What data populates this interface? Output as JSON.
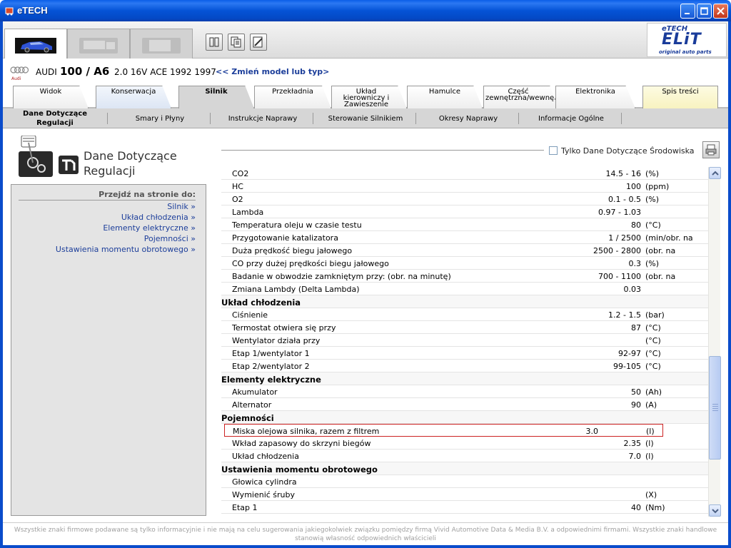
{
  "window": {
    "title": "eTECH",
    "icon": "etech-app-icon",
    "controls": [
      "minimize-icon",
      "maximize-icon",
      "close-icon"
    ]
  },
  "toolbar": {
    "vehicle_tabs": [
      {
        "name": "car",
        "icon": "car-icon",
        "active": true
      },
      {
        "name": "truck",
        "icon": "truck-icon",
        "active": false
      },
      {
        "name": "other",
        "icon": "van-icon",
        "active": false
      }
    ],
    "tools": [
      "tool-book-icon",
      "tool-copy-icon",
      "tool-edit-icon"
    ],
    "logo": {
      "top": "eTECH",
      "main": "ELiT",
      "sub": "original auto parts"
    }
  },
  "model": {
    "brand_logo_text": "Audi",
    "make": "AUDI",
    "name": "100 / A6",
    "spec": "2.0 16V ACE 1992 1997",
    "change_link": "<< Zmień model lub typ>"
  },
  "main_tabs": [
    {
      "label": "Widok",
      "style": "white"
    },
    {
      "label": "Konserwacja",
      "style": "blue"
    },
    {
      "label": "Silnik",
      "style": "active"
    },
    {
      "label": "Przekładnia",
      "style": "white"
    },
    {
      "label": "Układ kierowniczy i Zawieszenie",
      "style": "white"
    },
    {
      "label": "Hamulce",
      "style": "white"
    },
    {
      "label": "Część zewnętrzna/wewnętrzna",
      "style": "white"
    },
    {
      "label": "Elektronika",
      "style": "white"
    },
    {
      "label": "Spis treści",
      "style": "yellow"
    }
  ],
  "sub_nav": [
    {
      "label": "Dane Dotyczące Regulacji",
      "active": true
    },
    {
      "label": "Smary i Płyny",
      "active": false
    },
    {
      "label": "Instrukcje Naprawy",
      "active": false
    },
    {
      "label": "Sterowanie Silnikiem",
      "active": false
    },
    {
      "label": "Okresy Naprawy",
      "active": false
    },
    {
      "label": "Informacje Ogólne",
      "active": false
    }
  ],
  "left": {
    "section_title": "Dane Dotyczące Regulacji",
    "jump_title": "Przejdź na stronie do:",
    "jump_links": [
      "Silnik »",
      "Układ chłodzenia »",
      "Elementy elektryczne »",
      "Pojemności »",
      "Ustawienia momentu obrotowego »"
    ]
  },
  "right": {
    "env_checkbox_label": "Tylko Dane Dotyczące Środowiska",
    "env_checked": false,
    "rows": [
      {
        "type": "item",
        "name": "CO2",
        "value": "14.5 - 16",
        "unit": "(%)"
      },
      {
        "type": "item",
        "name": "HC",
        "value": "100",
        "unit": "(ppm)"
      },
      {
        "type": "item",
        "name": "O2",
        "value": "0.1 - 0.5",
        "unit": "(%)"
      },
      {
        "type": "item",
        "name": "Lambda",
        "value": "0.97 - 1.03",
        "unit": ""
      },
      {
        "type": "item",
        "name": "Temperatura oleju w czasie testu",
        "value": "80",
        "unit": "(°C)"
      },
      {
        "type": "item",
        "name": "Przygotowanie katalizatora",
        "value": "1 / 2500",
        "unit": "(min/obr. na"
      },
      {
        "type": "item",
        "name": "Duża prędkość biegu jałowego",
        "value": "2500 - 2800",
        "unit": "(obr. na"
      },
      {
        "type": "item",
        "name": "CO przy dużej prędkości biegu jałowego",
        "value": "0.3",
        "unit": "(%)"
      },
      {
        "type": "item",
        "name": "Badanie w obwodzie zamkniętym przy: (obr. na minutę)",
        "value": "700 - 1100",
        "unit": "(obr. na"
      },
      {
        "type": "item",
        "name": "Zmiana Lambdy (Delta Lambda)",
        "value": "0.03",
        "unit": ""
      },
      {
        "type": "header",
        "name": "Układ chłodzenia",
        "value": "",
        "unit": ""
      },
      {
        "type": "item",
        "name": "Ciśnienie",
        "value": "1.2 - 1.5",
        "unit": "(bar)"
      },
      {
        "type": "item",
        "name": "Termostat otwiera się przy",
        "value": "87",
        "unit": "(°C)"
      },
      {
        "type": "item",
        "name": "Wentylator działa przy",
        "value": "",
        "unit": "(°C)"
      },
      {
        "type": "item",
        "name": "Etap 1/wentylator 1",
        "value": "92-97",
        "unit": "(°C)"
      },
      {
        "type": "item",
        "name": "Etap 2/wentylator 2",
        "value": "99-105",
        "unit": "(°C)"
      },
      {
        "type": "header",
        "name": "Elementy elektryczne",
        "value": "",
        "unit": ""
      },
      {
        "type": "item",
        "name": "Akumulator",
        "value": "50",
        "unit": "(Ah)"
      },
      {
        "type": "item",
        "name": "Alternator",
        "value": "90",
        "unit": "(A)"
      },
      {
        "type": "header",
        "name": "Pojemności",
        "value": "",
        "unit": ""
      },
      {
        "type": "highlight",
        "name": "Miska olejowa silnika, razem z filtrem",
        "value": "3.0",
        "unit": "(l)"
      },
      {
        "type": "item",
        "name": "Wkład zapasowy do skrzyni biegów",
        "value": "2.35",
        "unit": "(l)"
      },
      {
        "type": "item",
        "name": "Układ chłodzenia",
        "value": "7.0",
        "unit": "(l)"
      },
      {
        "type": "header",
        "name": "Ustawienia momentu obrotowego",
        "value": "",
        "unit": ""
      },
      {
        "type": "item",
        "name": "Głowica cylindra",
        "value": "",
        "unit": ""
      },
      {
        "type": "item",
        "name": "Wymienić śruby",
        "value": "",
        "unit": "(X)"
      },
      {
        "type": "item",
        "name": "Etap 1",
        "value": "40",
        "unit": "(Nm)"
      }
    ]
  },
  "footer": "Wszystkie znaki firmowe podawane są tylko informacyjnie i nie mają na celu sugerowania jakiegokolwiek związku pomiędzy firmą Vivid Automotive Data & Media B.V. a odpowiednimi firmami. Wszystkie znaki handlowe stanowią własność odpowiednich właścicieli",
  "colors": {
    "titlebar": "#0553d6",
    "link": "#1c3e9a",
    "highlight_border": "#cc2222"
  }
}
